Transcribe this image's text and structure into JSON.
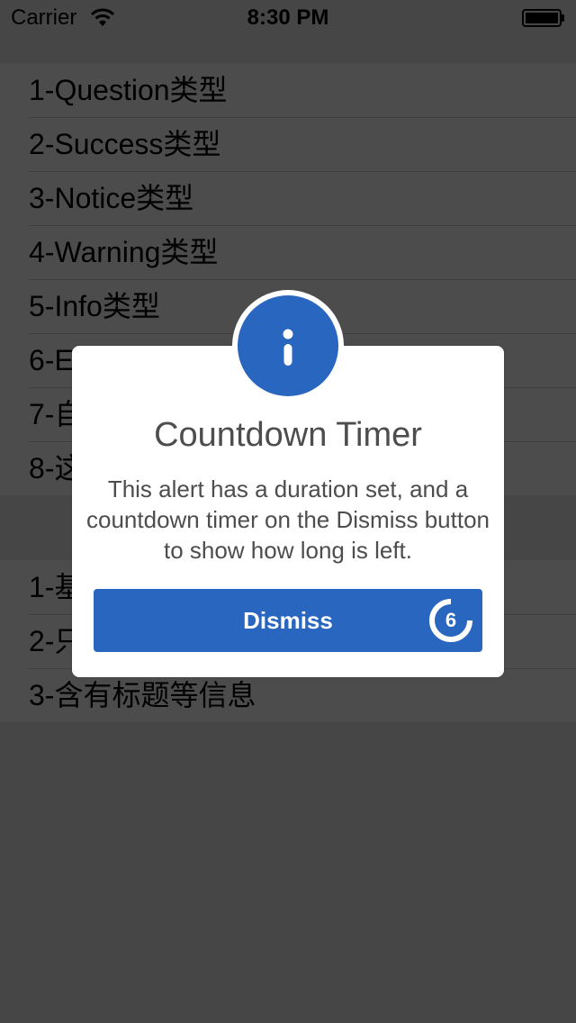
{
  "status_bar": {
    "carrier": "Carrier",
    "time": "8:30 PM",
    "wifi_icon": "wifi-icon",
    "battery_icon": "battery-full-icon"
  },
  "table": {
    "sections": [
      {
        "rows": [
          "1-Question类型",
          "2-Success类型",
          "3-Notice类型",
          "4-Warning类型",
          "5-Info类型",
          "6-E",
          "7-自",
          "8-这"
        ]
      },
      {
        "rows": [
          "1-基",
          "2-只",
          "3-含有标题等信息"
        ]
      }
    ]
  },
  "alert": {
    "icon": "info-icon",
    "title": "Countdown Timer",
    "message": "This alert has a duration set, and a countdown timer on the Dismiss button to show how long is left.",
    "button_label": "Dismiss",
    "countdown_value": "6",
    "countdown_progress": 0.75,
    "accent_color": "#2866bf"
  }
}
